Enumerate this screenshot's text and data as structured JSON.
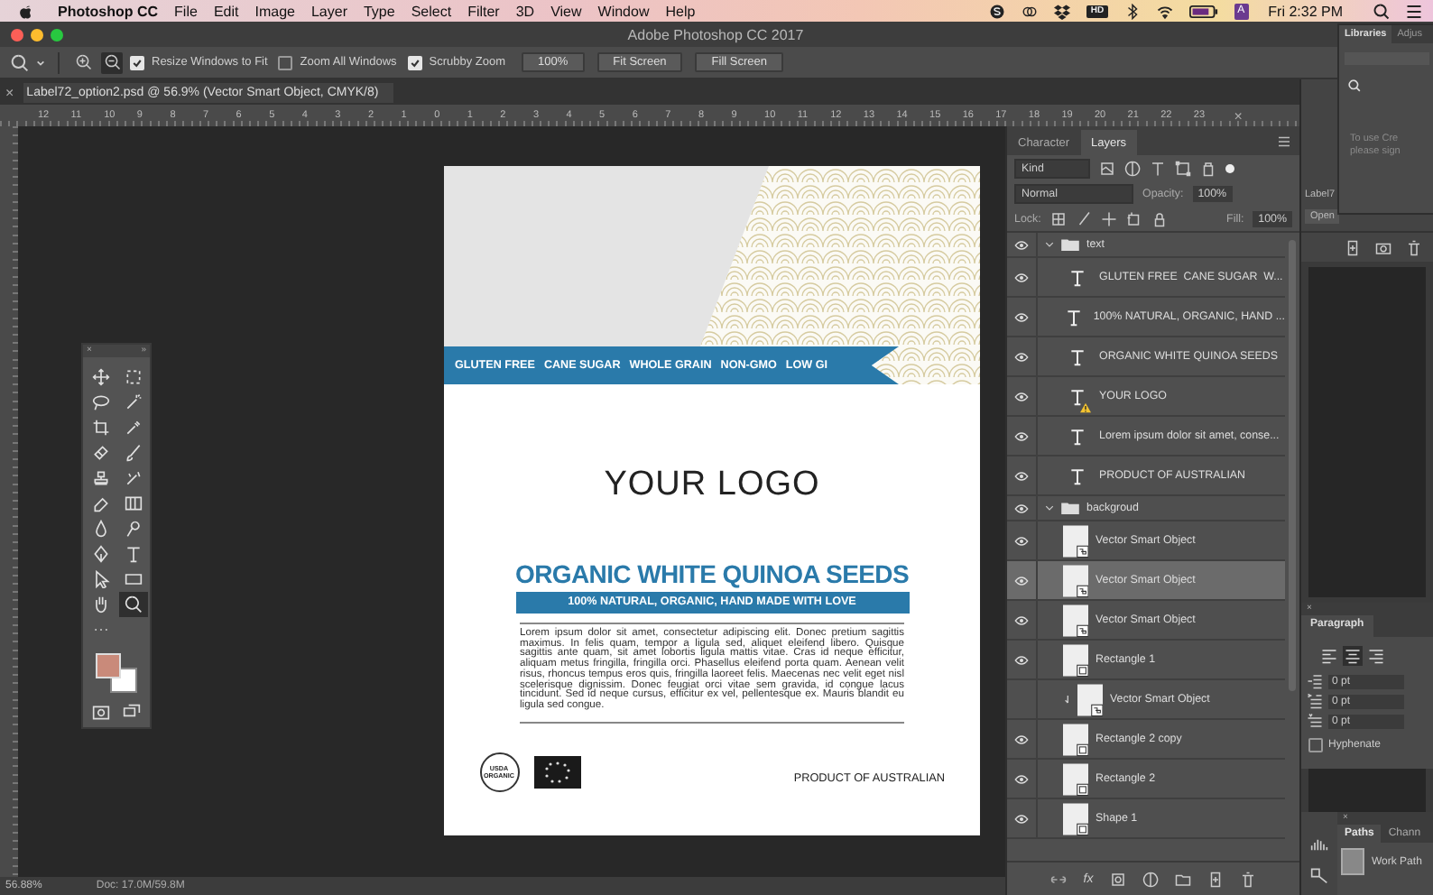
{
  "menubar": {
    "app": "Photoshop CC",
    "menus": [
      "File",
      "Edit",
      "Image",
      "Layer",
      "Type",
      "Select",
      "Filter",
      "3D",
      "View",
      "Window",
      "Help"
    ],
    "status_icons": [
      {
        "kind": "skype"
      },
      {
        "kind": "cc"
      },
      {
        "kind": "dropbox"
      },
      {
        "kind": "hd",
        "text": "HD"
      },
      {
        "kind": "bluetooth"
      },
      {
        "kind": "wifi"
      },
      {
        "kind": "battery"
      },
      {
        "kind": "input",
        "text": "A"
      }
    ],
    "clock": "Fri 2:32 PM"
  },
  "window": {
    "title": "Adobe Photoshop CC 2017"
  },
  "options_bar": {
    "zoom_modes": [
      {
        "kind": "in",
        "selected": false
      },
      {
        "kind": "out",
        "selected": true
      }
    ],
    "checkboxes": [
      {
        "label": "Resize Windows to Fit",
        "checked": true
      },
      {
        "label": "Zoom All Windows",
        "checked": false
      },
      {
        "label": "Scrubby Zoom",
        "checked": true
      }
    ],
    "buttons": [
      "100%",
      "Fit Screen",
      "Fill Screen"
    ]
  },
  "document_tab": {
    "close": "×",
    "title": "Label72_option2.psd @ 56.9% (Vector Smart Object, CMYK/8)"
  },
  "ruler": {
    "labels": [
      "12",
      "11",
      "10",
      "9",
      "8",
      "7",
      "6",
      "5",
      "4",
      "3",
      "2",
      "1",
      "0",
      "1",
      "2",
      "3",
      "4",
      "5",
      "6",
      "7",
      "8",
      "9",
      "10",
      "11",
      "12",
      "13",
      "14",
      "15",
      "16",
      "17",
      "18",
      "19",
      "20",
      "21",
      "22",
      "23"
    ]
  },
  "tools_panel": {
    "close": "×",
    "collapse": "»",
    "tools": [
      {
        "kind": "move",
        "selected": false
      },
      {
        "kind": "marquee",
        "selected": false
      },
      {
        "kind": "lasso",
        "selected": false
      },
      {
        "kind": "wand",
        "selected": false
      },
      {
        "kind": "crop",
        "selected": false
      },
      {
        "kind": "eyedropper",
        "selected": false
      },
      {
        "kind": "healing",
        "selected": false
      },
      {
        "kind": "brush",
        "selected": false
      },
      {
        "kind": "stamp",
        "selected": false
      },
      {
        "kind": "history",
        "selected": false
      },
      {
        "kind": "eraser",
        "selected": false
      },
      {
        "kind": "gradient",
        "selected": false
      },
      {
        "kind": "blur",
        "selected": false
      },
      {
        "kind": "dodge",
        "selected": false
      },
      {
        "kind": "pen",
        "selected": false
      },
      {
        "kind": "type",
        "selected": false
      },
      {
        "kind": "select",
        "selected": false
      },
      {
        "kind": "rectangle",
        "selected": false
      },
      {
        "kind": "hand",
        "selected": false
      },
      {
        "kind": "zoom",
        "selected": true
      },
      {
        "kind": "more",
        "selected": false
      }
    ]
  },
  "label": {
    "badges": [
      "GLUTEN FREE",
      "CANE SUGAR",
      "WHOLE GRAIN",
      "NON-GMO",
      "LOW GI"
    ],
    "logo": "YOUR LOGO",
    "title": "ORGANIC WHITE QUINOA SEEDS",
    "subtitle": "100% NATURAL, ORGANIC, HAND MADE WITH LOVE",
    "body": "Lorem ipsum dolor sit amet, consectetur adipiscing elit. Donec pretium sagittis maximus. In felis quam, tempor a ligula sed, aliquet eleifend libero. Quisque sagittis ante quam, sit amet lobortis ligula mattis vitae. Cras id neque efficitur, aliquam metus fringilla, fringilla orci. Phasellus eleifend porta quam. Aenean velit risus, rhoncus tempus eros quis, fringilla laoreet felis. Maecenas nec velit eget nisl scelerisque dignissim. Donec feugiat orci vitae sem gravida, id congue lacus tincidunt. Sed id neque cursus, efficitur ex vel, pellentesque ex. Mauris blandit eu ligula sed congue.",
    "seal": [
      "USDA",
      "ORGANIC"
    ],
    "origin": "PRODUCT OF AUSTRALIAN"
  },
  "status_bar": {
    "zoom": "56.88%",
    "doc": "Doc: 17.0M/59.8M"
  },
  "layers_panel": {
    "close": "×",
    "tabs": [
      {
        "label": "Character",
        "selected": false
      },
      {
        "label": "Layers",
        "selected": true
      }
    ],
    "filter": "Kind",
    "blend_mode": "Normal",
    "opacity_label": "Opacity:",
    "opacity": "100%",
    "lock_label": "Lock:",
    "fill_label": "Fill:",
    "fill": "100%",
    "bottom_fx": "fx",
    "layers": [
      {
        "name": "text",
        "kind": "group",
        "visible": true,
        "selected": false,
        "expanded": true,
        "children": [
          {
            "name": "GLUTEN FREE  CANE SUGAR  W...",
            "kind": "text",
            "visible": true,
            "selected": false,
            "warning": false,
            "clipped": false
          },
          {
            "name": "100% NATURAL, ORGANIC, HAND ...",
            "kind": "text",
            "visible": true,
            "selected": false,
            "warning": false,
            "clipped": false
          },
          {
            "name": "ORGANIC WHITE QUINOA SEEDS",
            "kind": "text",
            "visible": true,
            "selected": false,
            "warning": false,
            "clipped": false
          },
          {
            "name": "YOUR LOGO",
            "kind": "text",
            "visible": true,
            "selected": false,
            "warning": true,
            "clipped": false
          },
          {
            "name": "Lorem ipsum dolor sit amet, conse...",
            "kind": "text",
            "visible": true,
            "selected": false,
            "warning": false,
            "clipped": false
          },
          {
            "name": "PRODUCT OF AUSTRALIAN",
            "kind": "text",
            "visible": true,
            "selected": false,
            "warning": false,
            "clipped": false
          }
        ]
      },
      {
        "name": "backgroud",
        "kind": "group",
        "visible": true,
        "selected": false,
        "expanded": true,
        "children": [
          {
            "name": "Vector Smart Object",
            "kind": "smart",
            "visible": true,
            "selected": false,
            "warning": false,
            "clipped": false
          },
          {
            "name": "Vector Smart Object",
            "kind": "smart",
            "visible": true,
            "selected": true,
            "warning": false,
            "clipped": false
          },
          {
            "name": "Vector Smart Object",
            "kind": "smart",
            "visible": true,
            "selected": false,
            "warning": false,
            "clipped": false
          },
          {
            "name": "Rectangle 1",
            "kind": "shape",
            "visible": true,
            "selected": false,
            "warning": false,
            "clipped": false
          },
          {
            "name": "Vector Smart Object",
            "kind": "smart",
            "visible": false,
            "selected": false,
            "warning": false,
            "clipped": true
          },
          {
            "name": "Rectangle 2 copy",
            "kind": "shape",
            "visible": true,
            "selected": false,
            "warning": false,
            "clipped": false
          },
          {
            "name": "Rectangle 2",
            "kind": "shape",
            "visible": true,
            "selected": false,
            "warning": false,
            "clipped": false
          },
          {
            "name": "Shape 1",
            "kind": "shape",
            "visible": true,
            "selected": false,
            "warning": false,
            "clipped": false
          }
        ]
      }
    ]
  },
  "libraries_panel": {
    "tabs": [
      {
        "label": "Libraries",
        "selected": true
      },
      {
        "label": "Adjus",
        "selected": false
      }
    ],
    "message": [
      "To use Cre",
      "please sign"
    ]
  },
  "side_panel": {
    "tab": "Label7",
    "button": "Open"
  },
  "paragraph_panel": {
    "close": "×",
    "tab": "Paragraph",
    "alignments": [
      {
        "kind": "left",
        "selected": false
      },
      {
        "kind": "center",
        "selected": true
      },
      {
        "kind": "right",
        "selected": false
      }
    ],
    "indents": [
      {
        "kind": "left",
        "value": "0 pt"
      },
      {
        "kind": "first",
        "value": "0 pt"
      },
      {
        "kind": "before",
        "value": "0 pt"
      }
    ],
    "hyphenate": {
      "label": "Hyphenate",
      "checked": false
    }
  },
  "paths_panel": {
    "close": "×",
    "tabs": [
      {
        "label": "Paths",
        "selected": true
      },
      {
        "label": "Chann",
        "selected": false
      }
    ],
    "items": [
      "Work Path"
    ]
  }
}
